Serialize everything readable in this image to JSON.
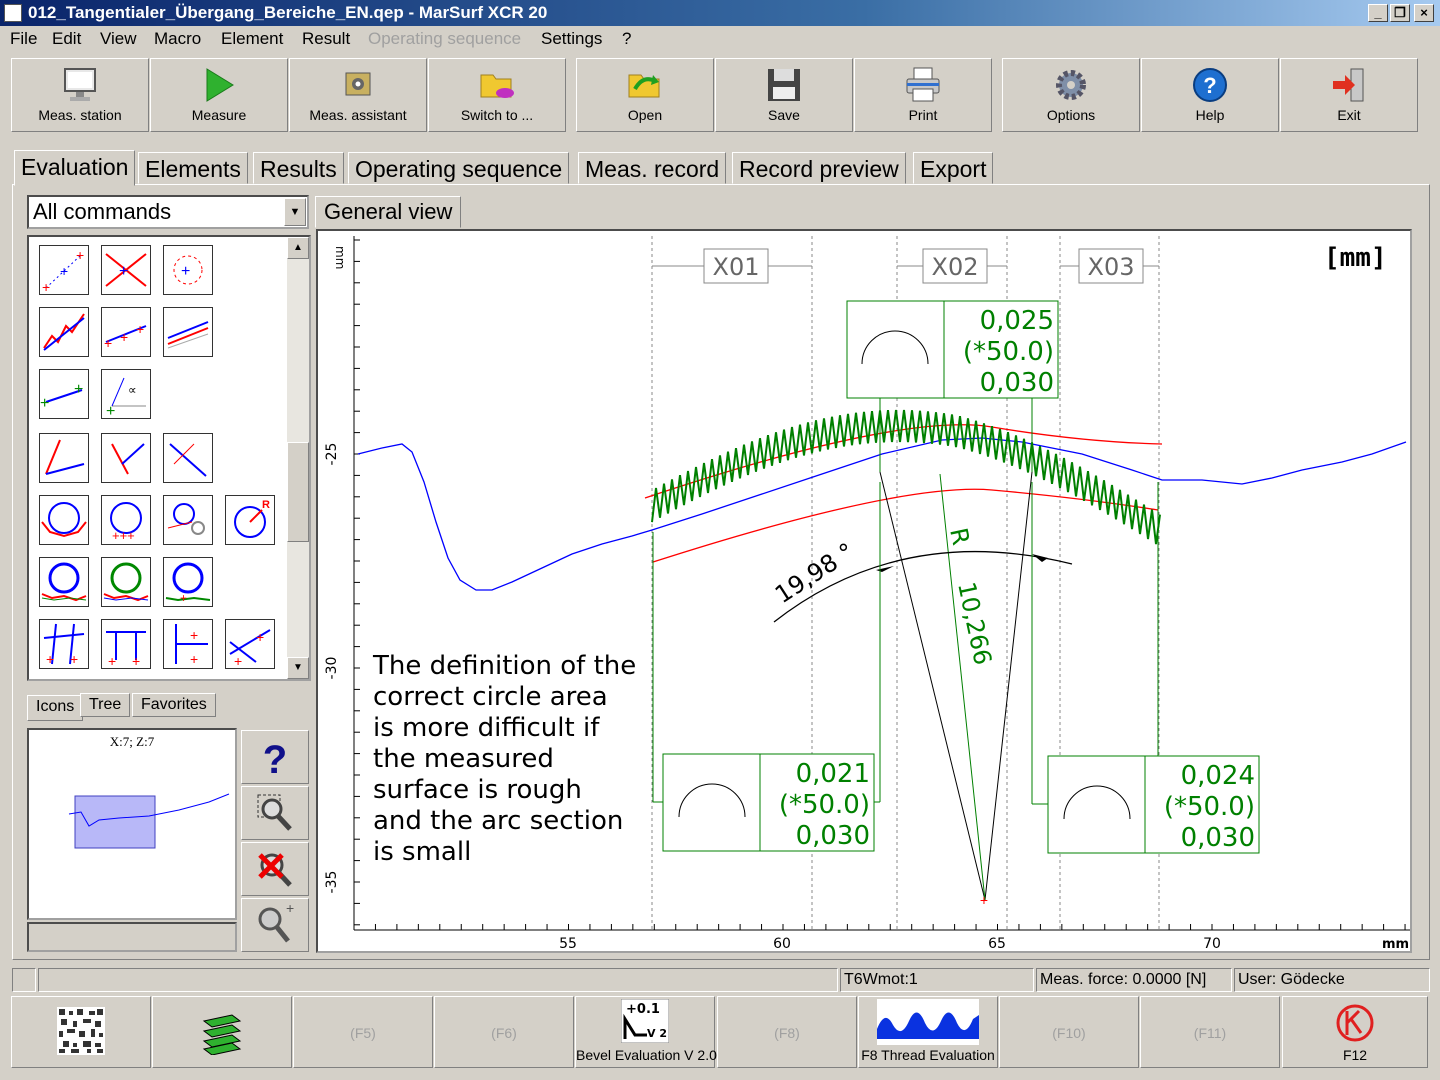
{
  "window": {
    "title": "012_Tangentialer_Übergang_Bereiche_EN.qep - MarSurf XCR 20"
  },
  "menu": [
    "File",
    "Edit",
    "View",
    "Macro",
    "Element",
    "Result",
    "Operating sequence",
    "Settings",
    "?"
  ],
  "toolbar": {
    "meas_station": "Meas. station",
    "measure": "Measure",
    "meas_assistant": "Meas. assistant",
    "switch_to": "Switch to ...",
    "open": "Open",
    "save": "Save",
    "print": "Print",
    "options": "Options",
    "help": "Help",
    "exit": "Exit"
  },
  "tabs": [
    "Evaluation",
    "Elements",
    "Results",
    "Operating sequence",
    "Meas. record",
    "Record preview",
    "Export"
  ],
  "command_filter": "All commands",
  "left_tabs": [
    "Icons",
    "Tree",
    "Favorites"
  ],
  "preview": {
    "coord": "X:7; Z:7"
  },
  "view_tab": "General view",
  "graph": {
    "unit": "[mm]",
    "x_ticks": [
      "55",
      "60",
      "65",
      "70"
    ],
    "x_unit": "mm",
    "y_ticks": [
      "-25",
      "-30",
      "-35"
    ],
    "y_unit": "mm",
    "zones": [
      "X01",
      "X02",
      "X03"
    ],
    "angle_label": "19,98 °",
    "radius_prefix": "R",
    "radius_label": "10,266",
    "boxes": [
      {
        "v1": "0,025",
        "v2": "(*50.0)",
        "v3": "0,030"
      },
      {
        "v1": "0,021",
        "v2": "(*50.0)",
        "v3": "0,030"
      },
      {
        "v1": "0,024",
        "v2": "(*50.0)",
        "v3": "0,030"
      }
    ],
    "note": [
      "The definition of the",
      "correct circle area",
      "is more difficult if",
      "the measured",
      "surface is rough",
      "and the arc section",
      "is small"
    ]
  },
  "status": {
    "cell3": "T6Wmot:1",
    "cell4": "Meas. force: 0.0000 [N]",
    "cell5": "User: Gödecke"
  },
  "fkeys": {
    "f5": "(F5)",
    "f6": "(F6)",
    "f7": "Bevel Evaluation V 2.0",
    "f7_icon_top": "+0.1",
    "f7_icon_bottom": "V 2",
    "f8": "(F8)",
    "f9": "F8 Thread Evaluation",
    "f10": "(F10)",
    "f11": "(F11)",
    "f12": "F12"
  },
  "colors": {
    "profile": "#0000ff",
    "fit": "#008000",
    "tolerance": "#ff0000"
  }
}
